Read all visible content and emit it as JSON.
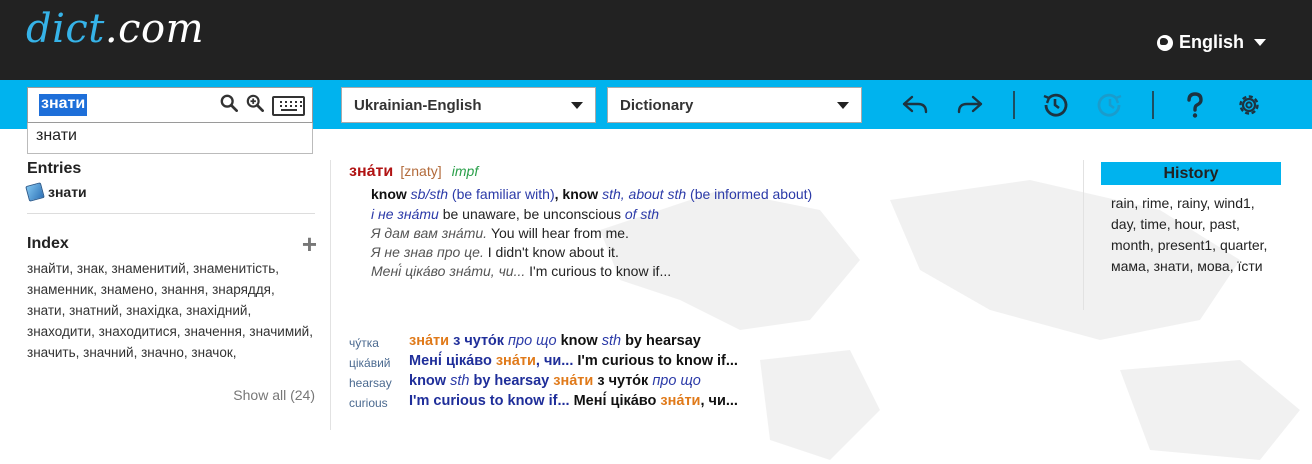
{
  "header": {
    "logo_part1": "dict",
    "logo_part2": ".com",
    "language": "English"
  },
  "toolbar": {
    "search_value": "знати",
    "suggestion": "знати",
    "language_pair": "Ukrainian-English",
    "mode": "Dictionary"
  },
  "left": {
    "entries_heading": "Entries",
    "entry": "знати",
    "index_heading": "Index",
    "index_text": "знайти, знак, знаменитий, знаменитість, знаменник, знамено, знання, знаряддя, знати, знатний, знахідка, знахідний, знаходити, знаходитися, значення, значимий, значить, значний, значно, значок,",
    "show_all": "Show all (24)"
  },
  "entry": {
    "headword": "зна́ти",
    "translit": "[znaty]",
    "pos": "impf",
    "sense1": {
      "t1": "know",
      "t2": "sb/sth",
      "t3": "(be familiar with)",
      "t4": ", ",
      "t5": "know",
      "t6": "sth, about sth",
      "t7": "(be informed about)"
    },
    "ex1": {
      "src": "і не зна́ти",
      "en": "be unaware, be unconscious",
      "tail": "of sth"
    },
    "ex2": {
      "src": "Я дам вам зна́ти.",
      "en": "You will hear from me."
    },
    "ex3": {
      "src": "Я не знав про це.",
      "en": "I didn't know about it."
    },
    "ex4": {
      "src": "Мені́ ціка́во зна́ти, чи...",
      "en": "I'm curious to know if..."
    }
  },
  "phrases": [
    {
      "key": "чу́тка",
      "p1": "зна́ти",
      "p2": "з чуто́к",
      "p3": "про що",
      "p4": "know",
      "p5": "sth",
      "p6": "by hearsay"
    },
    {
      "key": "ціка́вий",
      "p1": "Мені́ ціка́во",
      "p2": "зна́ти",
      "p3": ", чи...",
      "p4": "I'm curious to know if..."
    },
    {
      "key": "hearsay",
      "p1": "know",
      "p2": "sth",
      "p3": "by hearsay",
      "p4": "зна́ти",
      "p5": "з чуто́к",
      "p6": "про що"
    },
    {
      "key": "curious",
      "p1": "I'm curious to know if...",
      "p2": "Мені́ ціка́во",
      "p3": "зна́ти",
      "p4": ", чи..."
    }
  ],
  "history": {
    "heading": "History",
    "items": "rain, rime, rainy, wind1, day, time, hour, past, month, present1, quarter, мама, знати, мова, їсти"
  },
  "colors": {
    "header_bg": "#222222",
    "toolbar_bg": "#00b3ee",
    "headword": "#b11313",
    "highlight": "#e07a1a"
  },
  "icons": [
    "globe-icon",
    "search-icon",
    "zoom-in-icon",
    "keyboard-icon",
    "undo-icon",
    "redo-icon",
    "history-icon",
    "refresh-icon",
    "help-icon",
    "settings-icon",
    "book-icon",
    "plus-icon"
  ]
}
